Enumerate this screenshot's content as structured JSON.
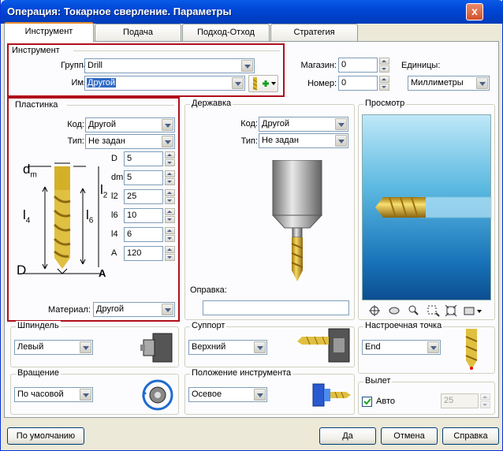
{
  "window": {
    "title": "Операция: Токарное сверление. Параметры",
    "close": "x"
  },
  "tabs": [
    "Инструмент",
    "Подача",
    "Подход-Отход",
    "Стратегия"
  ],
  "instrument": {
    "legend": "Инструмент",
    "group_label": "Группа:",
    "group_value": "Drill",
    "name_label": "Имя:",
    "name_value": "Другой"
  },
  "magazine": {
    "label": "Магазин:",
    "value": "0",
    "number_label": "Номер:",
    "number_value": "0"
  },
  "units": {
    "label": "Единицы:",
    "value": "Миллиметры"
  },
  "plate": {
    "legend": "Пластинка",
    "code_label": "Код:",
    "code_value": "Другой",
    "type_label": "Тип:",
    "type_value": "Не задан",
    "material_label": "Материал:",
    "material_value": "Другой",
    "params": [
      {
        "label": "D",
        "value": "5"
      },
      {
        "label": "dm",
        "value": "5"
      },
      {
        "label": "l2",
        "value": "25"
      },
      {
        "label": "l6",
        "value": "10"
      },
      {
        "label": "l4",
        "value": "6"
      },
      {
        "label": "A",
        "value": "120"
      }
    ],
    "diagram": {
      "dm": "d",
      "dm_sub": "m",
      "l4": "l",
      "l4_sub": "4",
      "l6": "l",
      "l6_sub": "6",
      "l2": "l",
      "l2_sub": "2",
      "D": "D",
      "A": "A"
    }
  },
  "holder": {
    "legend": "Державка",
    "code_label": "Код:",
    "code_value": "Другой",
    "type_label": "Тип:",
    "type_value": "Не задан",
    "mandrel_label": "Оправка:",
    "mandrel_value": ""
  },
  "preview": {
    "legend": "Просмотр"
  },
  "spindle": {
    "legend": "Шпиндель",
    "value": "Левый"
  },
  "support": {
    "legend": "Суппорт",
    "value": "Верхний"
  },
  "setpoint": {
    "legend": "Настроечная точка",
    "value": "End"
  },
  "rotation": {
    "legend": "Вращение",
    "value": "По часовой"
  },
  "toolpos": {
    "legend": "Положение инструмента",
    "value": "Осевое"
  },
  "overhang": {
    "legend": "Вылет",
    "auto_label": "Авто",
    "value": "25"
  },
  "buttons": {
    "default": "По умолчанию",
    "ok": "Да",
    "cancel": "Отмена",
    "help": "Справка"
  }
}
